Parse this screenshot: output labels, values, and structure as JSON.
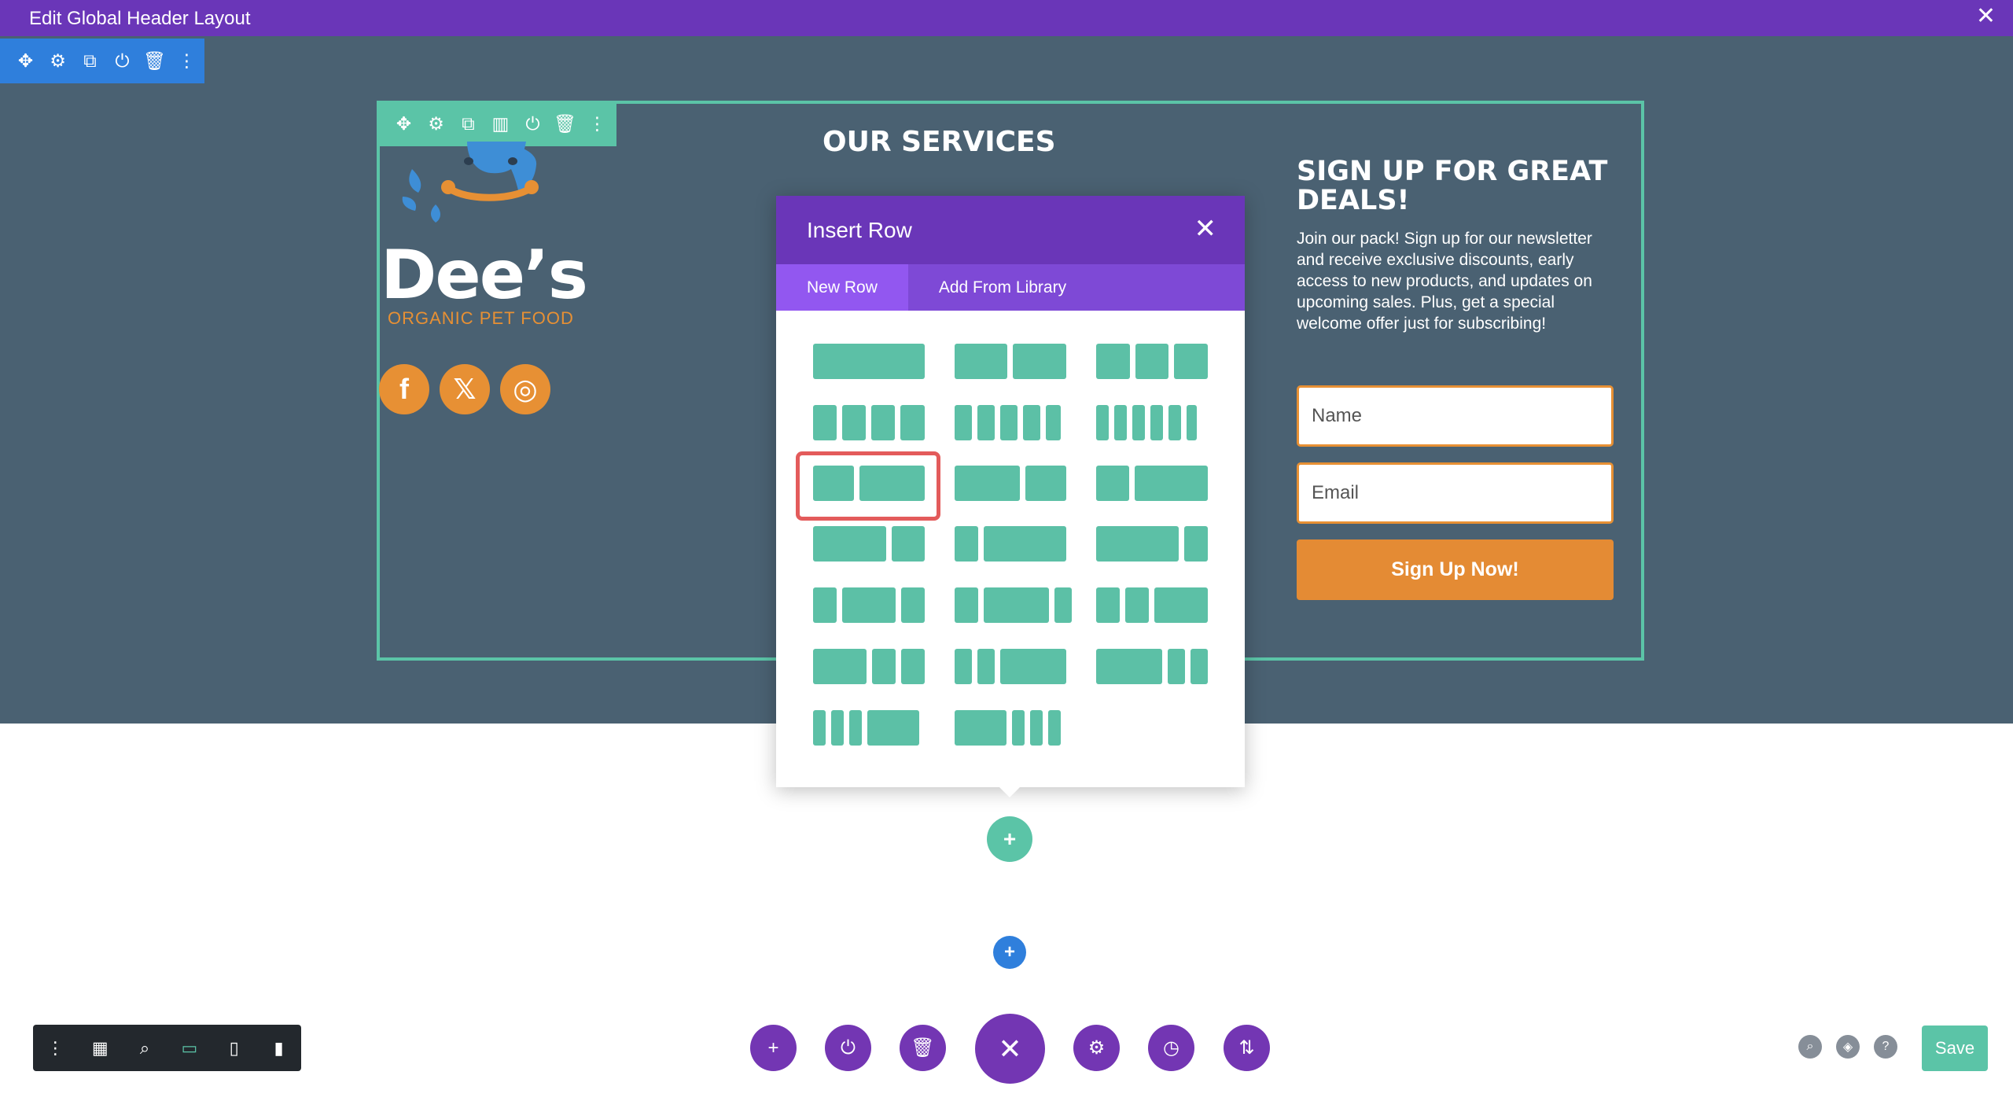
{
  "window": {
    "title": "Edit Global Header Layout",
    "close_icon": "✕"
  },
  "section_toolbar": {
    "icons": [
      "✥",
      "⚙",
      "⧉",
      "⏻",
      "🗑",
      "⋮"
    ],
    "icon_names": [
      "move-icon",
      "gear-icon",
      "duplicate-icon",
      "power-icon",
      "trash-icon",
      "more-icon"
    ]
  },
  "row_toolbar": {
    "icons": [
      "✥",
      "⚙",
      "⧉",
      "▥",
      "⏻",
      "🗑",
      "⋮"
    ],
    "icon_names": [
      "move-icon",
      "gear-icon",
      "duplicate-icon",
      "columns-icon",
      "power-icon",
      "trash-icon",
      "more-icon"
    ]
  },
  "logo": {
    "name": "Dee’s",
    "subtitle": "ORGANIC PET FOOD"
  },
  "social": [
    {
      "name": "facebook-icon",
      "glyph": "f"
    },
    {
      "name": "x-icon",
      "glyph": "𝕏"
    },
    {
      "name": "instagram-icon",
      "glyph": "◎"
    }
  ],
  "services": {
    "title": "OUR SERVICES"
  },
  "signup": {
    "title": "SIGN UP FOR GREAT DEALS!",
    "text": "Join our pack! Sign up for our newsletter and receive exclusive discounts, early access to new products, and updates on upcoming sales. Plus, get a special welcome offer just for subscribing!",
    "name_placeholder": "Name",
    "email_placeholder": "Email",
    "button": "Sign Up Now!"
  },
  "modal": {
    "title": "Insert Row",
    "close": "✕",
    "tabs": [
      {
        "label": "New Row",
        "active": true
      },
      {
        "label": "Add From Library",
        "active": false
      }
    ]
  },
  "add_buttons": {
    "green": "+",
    "blue": "+"
  },
  "bottom_left": {
    "icons": [
      "⋮",
      "▦",
      "⌕",
      "▭",
      "▯",
      "▮"
    ],
    "icon_names": [
      "more-icon",
      "wireframe-icon",
      "zoom-icon",
      "desktop-icon",
      "tablet-icon",
      "phone-icon"
    ],
    "active": 3
  },
  "bottom_center": {
    "icons": [
      "+",
      "⏻",
      "🗑",
      "✕",
      "⚙",
      "◷",
      "⇅"
    ],
    "icon_names": [
      "add-icon",
      "power-icon",
      "trash-icon",
      "close-icon",
      "gear-icon",
      "history-icon",
      "portability-icon"
    ]
  },
  "bottom_right": {
    "icons": [
      "⌕",
      "◈",
      "?"
    ],
    "icon_names": [
      "search-icon",
      "layers-icon",
      "help-icon"
    ],
    "save": "Save"
  },
  "colors": {
    "purple": "#6a36b8",
    "teal": "#5bc4a7",
    "orange": "#e79034",
    "slate": "#4a6172",
    "blue": "#2f7fdc"
  }
}
